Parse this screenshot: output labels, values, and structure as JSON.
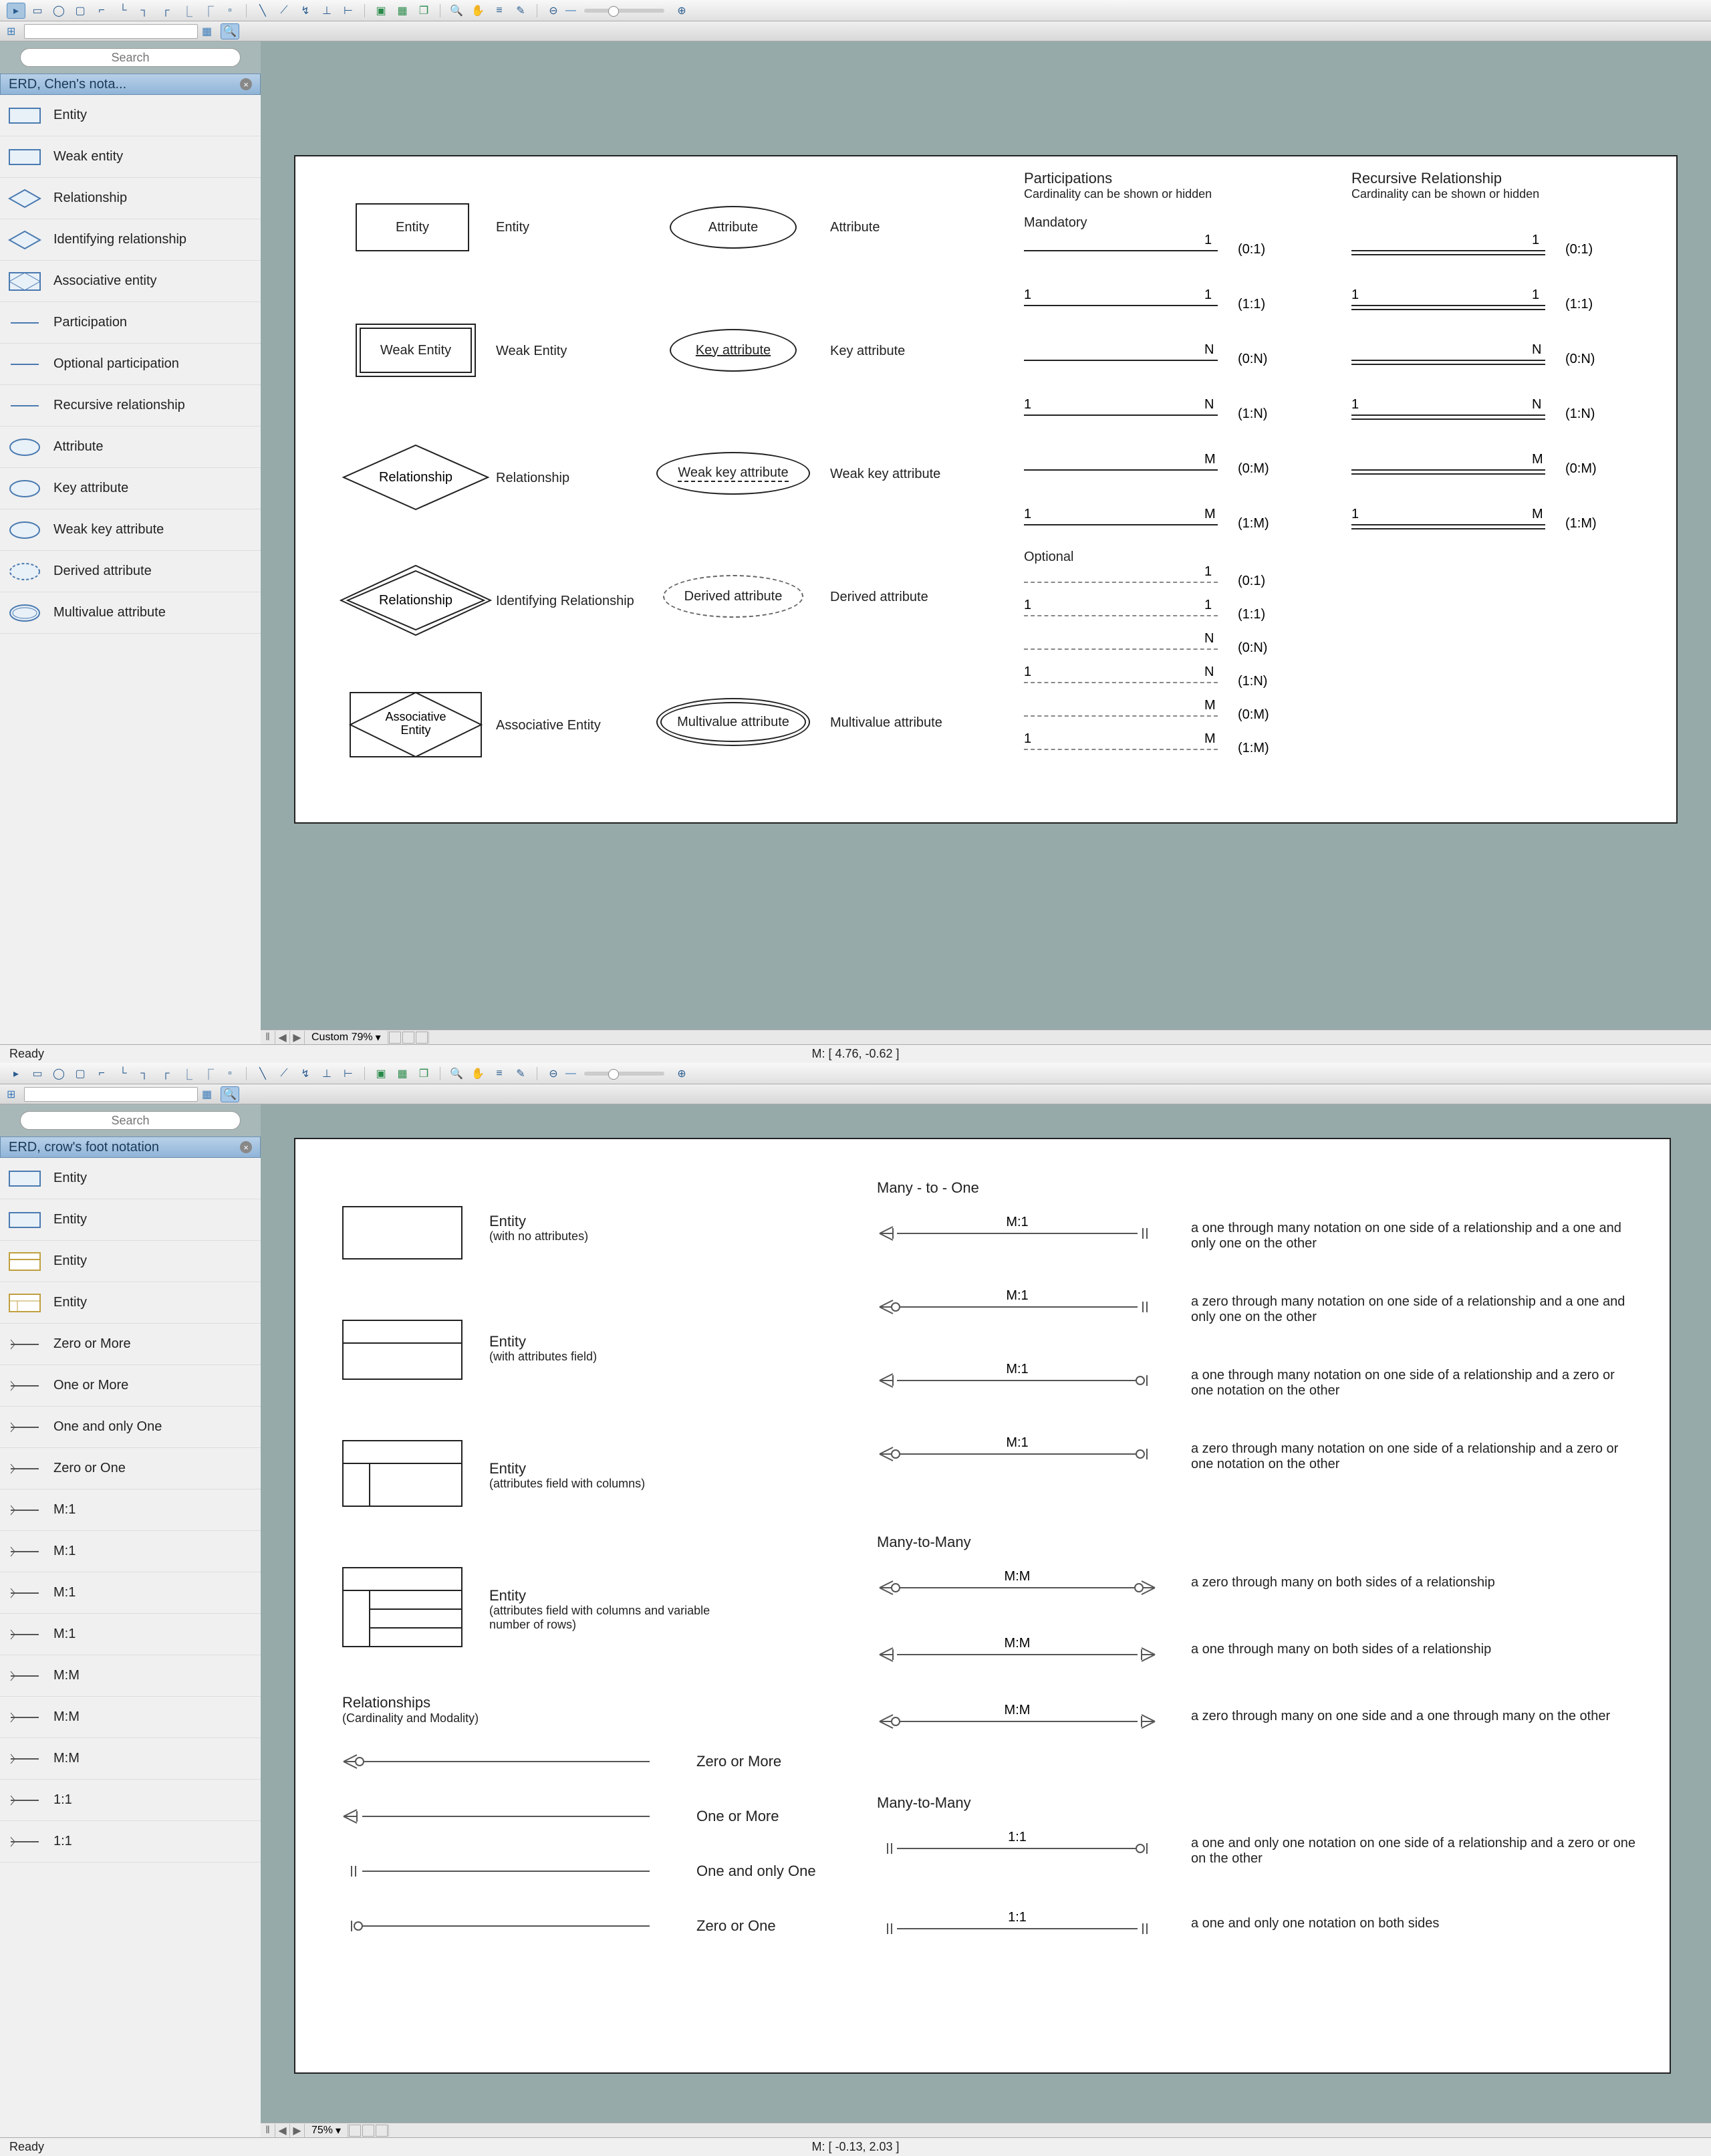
{
  "app1": {
    "toolbar_groups": [
      "cursor",
      "entity",
      "ellipse",
      "rect",
      "connector1",
      "connector2",
      "connector3",
      "connector4",
      "connector5",
      "connector6",
      "page",
      "line",
      "curve",
      "connector-ortho",
      "align-v",
      "align-h",
      "arrange",
      "group",
      "ungroup",
      "layers",
      "zoom-in",
      "hand",
      "align",
      "eyedrop",
      "zoom-out",
      "zoom-in2"
    ],
    "search_placeholder": "Search",
    "lib_title": "ERD, Chen's nota...",
    "lib_items": [
      {
        "icon": "rect",
        "label": "Entity"
      },
      {
        "icon": "rect",
        "label": "Weak entity"
      },
      {
        "icon": "diamond",
        "label": "Relationship"
      },
      {
        "icon": "diamond",
        "label": "Identifying relationship"
      },
      {
        "icon": "diamond-box",
        "label": "Associative entity"
      },
      {
        "icon": "line",
        "label": "Participation"
      },
      {
        "icon": "line",
        "label": "Optional participation"
      },
      {
        "icon": "line",
        "label": "Recursive relationship"
      },
      {
        "icon": "ellipse",
        "label": "Attribute"
      },
      {
        "icon": "ellipse",
        "label": "Key attribute"
      },
      {
        "icon": "ellipse",
        "label": "Weak key attribute"
      },
      {
        "icon": "ellipse-dash",
        "label": "Derived attribute"
      },
      {
        "icon": "ellipse-dbl",
        "label": "Multivalue attribute"
      }
    ],
    "canvas": {
      "shapes": [
        {
          "name": "Entity",
          "label": "Entity"
        },
        {
          "name": "Weak Entity",
          "label": "Weak Entity"
        },
        {
          "name": "Relationship",
          "label": "Relationship"
        },
        {
          "name": "Relationship",
          "label": "Identifying Relationship"
        },
        {
          "name": "Associative Entity",
          "label": "Associative Entity"
        }
      ],
      "attrs": [
        {
          "name": "Attribute",
          "label": "Attribute"
        },
        {
          "name": "Key attribute",
          "label": "Key attribute",
          "under": true
        },
        {
          "name": "Weak key attribute",
          "label": "Weak key attribute",
          "dashunder": true
        },
        {
          "name": "Derived attribute",
          "label": "Derived attribute",
          "dashed": true
        },
        {
          "name": "Multivalue attribute",
          "label": "Multivalue attribute",
          "double": true
        }
      ],
      "part_title": "Participations",
      "part_sub": "Cardinality can be shown or hidden",
      "rec_title": "Recursive Relationship",
      "rec_sub": "Cardinality can be shown or hidden",
      "mandatory": "Mandatory",
      "optional": "Optional",
      "participations": [
        {
          "l": "",
          "r": "1",
          "c": "(0:1)"
        },
        {
          "l": "1",
          "r": "1",
          "c": "(1:1)"
        },
        {
          "l": "",
          "r": "N",
          "c": "(0:N)"
        },
        {
          "l": "1",
          "r": "N",
          "c": "(1:N)"
        },
        {
          "l": "",
          "r": "M",
          "c": "(0:M)"
        },
        {
          "l": "1",
          "r": "M",
          "c": "(1:M)"
        }
      ],
      "optionals": [
        {
          "l": "",
          "r": "1",
          "c": "(0:1)"
        },
        {
          "l": "1",
          "r": "1",
          "c": "(1:1)"
        },
        {
          "l": "",
          "r": "N",
          "c": "(0:N)"
        },
        {
          "l": "1",
          "r": "N",
          "c": "(1:N)"
        },
        {
          "l": "",
          "r": "M",
          "c": "(0:M)"
        },
        {
          "l": "1",
          "r": "M",
          "c": "(1:M)"
        }
      ]
    },
    "zoom": "Custom 79%",
    "status": "Ready",
    "coords": "M: [ 4.76, -0.62 ]"
  },
  "app2": {
    "search_placeholder": "Search",
    "lib_title": "ERD, crow's foot notation",
    "lib_items": [
      {
        "icon": "rect",
        "label": "Entity"
      },
      {
        "icon": "rect",
        "label": "Entity"
      },
      {
        "icon": "rect-hdr",
        "label": "Entity"
      },
      {
        "icon": "rect-cols",
        "label": "Entity"
      },
      {
        "icon": "cf-0m",
        "label": "Zero or More"
      },
      {
        "icon": "cf-1m",
        "label": "One or More"
      },
      {
        "icon": "cf-11",
        "label": "One and only One"
      },
      {
        "icon": "cf-01",
        "label": "Zero or One"
      },
      {
        "icon": "cf",
        "label": "M:1"
      },
      {
        "icon": "cf",
        "label": "M:1"
      },
      {
        "icon": "cf",
        "label": "M:1"
      },
      {
        "icon": "cf",
        "label": "M:1"
      },
      {
        "icon": "cf",
        "label": "M:M"
      },
      {
        "icon": "cf",
        "label": "M:M"
      },
      {
        "icon": "cf",
        "label": "M:M"
      },
      {
        "icon": "cf",
        "label": "1:1"
      },
      {
        "icon": "cf",
        "label": "1:1"
      }
    ],
    "canvas": {
      "entities": [
        {
          "name": "Entity",
          "desc": "(with no attributes)"
        },
        {
          "name": "Entity",
          "desc": "(with attributes field)"
        },
        {
          "name": "Entity",
          "desc": "(attributes field with columns)"
        },
        {
          "name": "Entity",
          "desc": "(attributes field with columns and variable number of rows)"
        }
      ],
      "rel_title": "Relationships",
      "rel_sub": "(Cardinality and Modality)",
      "basic": [
        {
          "label": "Zero or More"
        },
        {
          "label": "One or More"
        },
        {
          "label": "One and only One"
        },
        {
          "label": "Zero or One"
        }
      ],
      "m1_title": "Many - to - One",
      "m1": [
        {
          "l": "crow",
          "r": "one-only",
          "lbl": "M:1",
          "desc": "a one through many notation on one side of a relationship and a one and only one on the other"
        },
        {
          "l": "crow-o",
          "r": "one-only",
          "lbl": "M:1",
          "desc": "a zero through many notation on one side of a relationship and a one and only one on the other"
        },
        {
          "l": "crow",
          "r": "zero-one",
          "lbl": "M:1",
          "desc": "a one through many notation on one side of a relationship and a zero or one notation on the other"
        },
        {
          "l": "crow-o",
          "r": "zero-one",
          "lbl": "M:1",
          "desc": "a zero through many notation on one side of a relationship and a zero or one notation on the other"
        }
      ],
      "mm_title": "Many-to-Many",
      "mm": [
        {
          "l": "crow-o",
          "r": "crow-o",
          "lbl": "M:M",
          "desc": "a zero through many on both sides of a relationship"
        },
        {
          "l": "crow",
          "r": "crow",
          "lbl": "M:M",
          "desc": "a one through many on both sides of a relationship"
        },
        {
          "l": "crow-o",
          "r": "crow",
          "lbl": "M:M",
          "desc": "a zero through many on one side and a one through many on the other"
        }
      ],
      "oo_title": "Many-to-Many",
      "oo": [
        {
          "l": "one-only",
          "r": "zero-one",
          "lbl": "1:1",
          "desc": "a one and only one notation on one side of a relationship and a zero or one on the other"
        },
        {
          "l": "one-only",
          "r": "one-only",
          "lbl": "1:1",
          "desc": "a one and only one notation on both sides"
        }
      ]
    },
    "zoom": "75%",
    "status": "Ready",
    "coords": "M: [ -0.13, 2.03 ]"
  }
}
